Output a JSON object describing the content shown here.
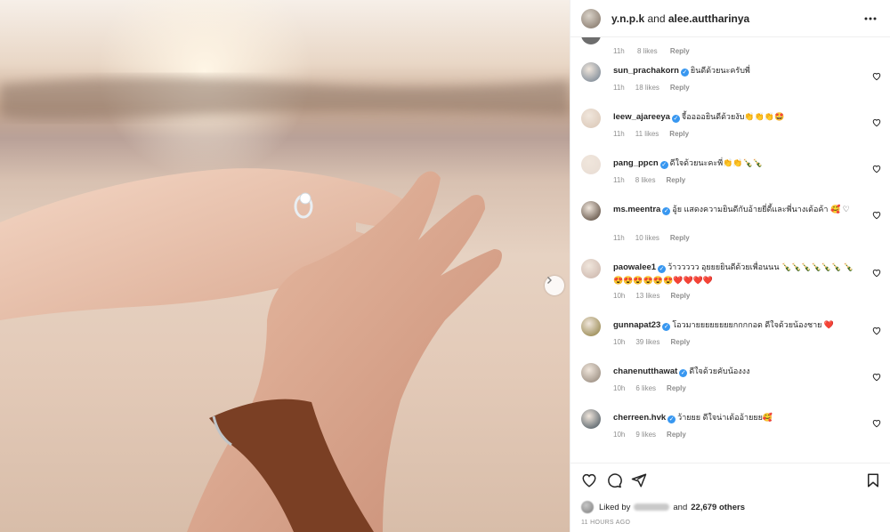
{
  "post": {
    "header": {
      "user1": "y.n.p.k",
      "connector": "and",
      "user2": "alee.auttharinya",
      "more_icon": "more-horizontal-icon"
    }
  },
  "partial_comment": {
    "time": "11h",
    "likes": "8 likes",
    "reply": "Reply"
  },
  "comments": [
    {
      "user": "sun_prachakorn",
      "verified": true,
      "text": "ยินดีด้วยนะครับพี่",
      "time": "11h",
      "likes": "18 likes",
      "reply": "Reply",
      "avatar_color": "#6b7b8c"
    },
    {
      "user": "leew_ajareeya",
      "verified": true,
      "text": "จี้ออออยินดีด้วยงับ👏👏👏🤩",
      "time": "11h",
      "likes": "11 likes",
      "reply": "Reply",
      "avatar_color": "#d9c5b4"
    },
    {
      "user": "pang_ppcn",
      "verified": true,
      "text": "ดีใจด้วยนะคะพี่👏👏🍾🍾",
      "time": "11h",
      "likes": "8 likes",
      "reply": "Reply",
      "avatar_color": "#e8dcd3"
    },
    {
      "user": "ms.meentra",
      "verified": true,
      "text": "อู้ย แสดงความยินดีกับอ้ายยี่ดี้และพี่นางเด้อค้า 🥰 ♡",
      "time": "11h",
      "likes": "10 likes",
      "reply": "Reply",
      "avatar_color": "#4a3a2e"
    },
    {
      "user": "paowalee1",
      "verified": true,
      "text": "ว้าววววว อุยยยยินดีด้วยเพื่อนนน 🍾🍾🍾🍾🍾🍾 🍾😍😍😍😍😍😍❤️❤️❤️❤️",
      "time": "10h",
      "likes": "13 likes",
      "reply": "Reply",
      "avatar_color": "#c9b2a8"
    },
    {
      "user": "gunnapat23",
      "verified": true,
      "text": "โอวมายยยยยยยยกกกกอด ดีใจด้วยน้องชาย ❤️",
      "time": "10h",
      "likes": "39 likes",
      "reply": "Reply",
      "avatar_color": "#8a7a3a"
    },
    {
      "user": "chanenutthawat",
      "verified": true,
      "text": "ดีใจด้วยคับน้องงง",
      "time": "10h",
      "likes": "6 likes",
      "reply": "Reply",
      "avatar_color": "#8c7f72"
    },
    {
      "user": "cherreen.hvk",
      "verified": true,
      "text": "ว้ายยย ดีใจน่าเด้ออ้ายยย🥰",
      "time": "10h",
      "likes": "9 likes",
      "reply": "Reply",
      "avatar_color": "#3b4a55"
    }
  ],
  "actions": {
    "like_icon": "heart-icon",
    "comment_icon": "comment-icon",
    "share_icon": "share-icon",
    "save_icon": "bookmark-icon"
  },
  "likes_summary": {
    "prefix": "Liked by",
    "connector": "and",
    "count": "22,679 others"
  },
  "timestamp": "11 HOURS AGO",
  "colors": {
    "verified": "#3897f0",
    "text": "#262626",
    "muted": "#8e8e8e",
    "divider": "#efefef"
  }
}
